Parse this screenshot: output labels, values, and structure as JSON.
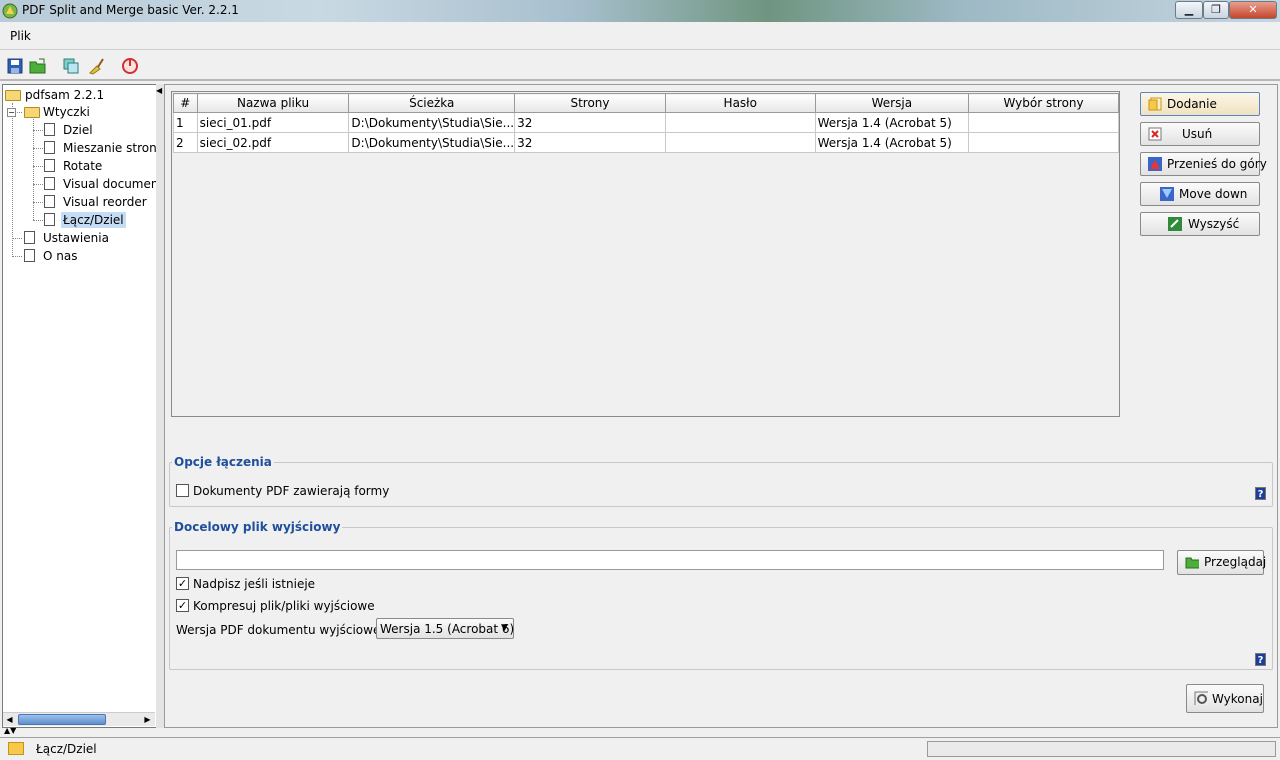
{
  "window": {
    "title": "PDF Split and Merge basic Ver. 2.2.1",
    "minimize": "▁",
    "maximize": "❐",
    "close": "✕"
  },
  "menu": {
    "file": "Plik"
  },
  "toolbar": {
    "icons": [
      "save-icon",
      "open-folder-icon",
      "copy-icon",
      "clean-icon",
      "power-icon"
    ]
  },
  "tree": {
    "root": "pdfsam 2.2.1",
    "plugins": "Wtyczki",
    "items": [
      "Dziel",
      "Mieszanie stron",
      "Rotate",
      "Visual document",
      "Visual reorder",
      "Łącz/Dziel"
    ],
    "settings": "Ustawienia",
    "about": "O nas"
  },
  "table": {
    "headers": [
      "#",
      "Nazwa pliku",
      "Ścieżka",
      "Strony",
      "Hasło",
      "Wersja",
      "Wybór strony"
    ],
    "rows": [
      [
        "1",
        "sieci_01.pdf",
        "D:\\Dokumenty\\Studia\\Sie...",
        "32",
        "",
        "Wersja 1.4 (Acrobat 5)",
        ""
      ],
      [
        "2",
        "sieci_02.pdf",
        "D:\\Dokumenty\\Studia\\Sie...",
        "32",
        "",
        "Wersja 1.4 (Acrobat 5)",
        ""
      ]
    ]
  },
  "buttons": {
    "add": "Dodanie",
    "remove": "Usuń",
    "move_up": "Przenieś do góry",
    "move_down": "Move down",
    "clear": "Wyszyść",
    "browse": "Przeglądaj",
    "run": "Wykonaj"
  },
  "merge_options": {
    "legend": "Opcje łączenia",
    "forms_label": "Dokumenty PDF zawierają formy",
    "forms_checked": false
  },
  "output": {
    "legend": "Docelowy plik wyjściowy",
    "path": "",
    "overwrite_label": "Nadpisz jeśli istnieje",
    "overwrite_checked": true,
    "compress_label": "Kompresuj plik/pliki wyjściowe",
    "compress_checked": true,
    "version_label": "Wersja PDF dokumentu wyjściowego:",
    "version_value": "Wersja 1.5 (Acrobat 6)"
  },
  "help": "?",
  "status": {
    "text": "Łącz/Dziel"
  }
}
